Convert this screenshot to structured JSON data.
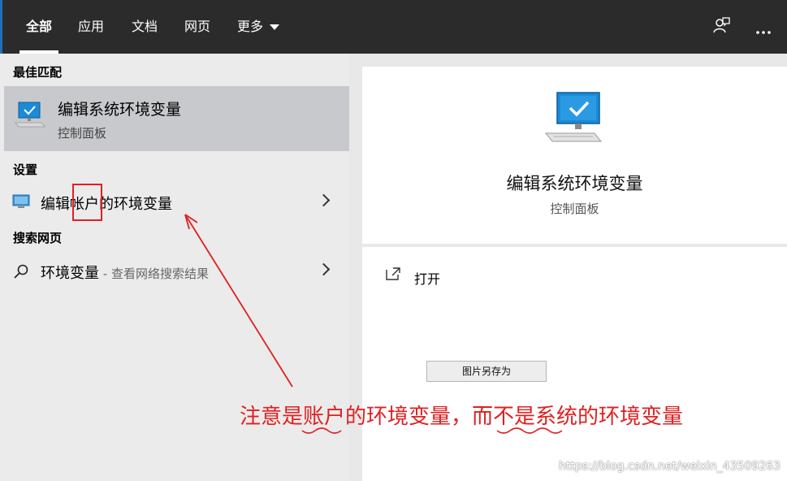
{
  "tabs": [
    {
      "label": "全部",
      "active": true
    },
    {
      "label": "应用",
      "active": false
    },
    {
      "label": "文档",
      "active": false
    },
    {
      "label": "网页",
      "active": false
    },
    {
      "label": "更多",
      "active": false,
      "has_dropdown": true
    }
  ],
  "top_icons": [
    "feedback-icon",
    "more-options-icon"
  ],
  "best_match": {
    "header": "最佳匹配",
    "title": "编辑系统环境变量",
    "subtitle": "控制面板",
    "icon": "monitor-check-icon"
  },
  "settings": {
    "header": "设置",
    "item": {
      "label": "编辑帐户的环境变量",
      "icon": "monitor-settings-icon"
    }
  },
  "web": {
    "header": "搜索网页",
    "item": {
      "label": "环境变量",
      "hint": " - 查看网络搜索结果",
      "icon": "search-icon"
    }
  },
  "preview": {
    "title": "编辑系统环境变量",
    "subtitle": "控制面板",
    "icon": "monitor-check-icon"
  },
  "actions": {
    "open_label": "打开",
    "open_icon": "open-external-icon"
  },
  "context_button": {
    "label": "图片另存为"
  },
  "annotation": {
    "text": "注意是账户的环境变量，而不是系统的环境变量",
    "color": "#e02020"
  },
  "watermark": "https://blog.csdn.net/weixin_43509263",
  "colors": {
    "topbar": "#2b2b2b",
    "selected_row": "#c7c9cc",
    "left_panel": "#ebebeb",
    "accent_blue": "#1e6fb8"
  }
}
